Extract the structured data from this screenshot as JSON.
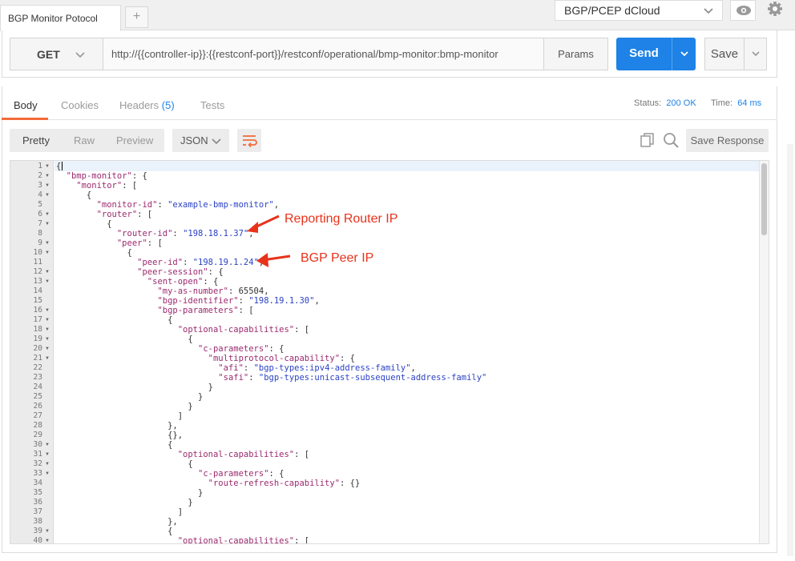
{
  "tabs": {
    "active_tab": "BGP Monitor Potocol",
    "add_label": "+"
  },
  "environment": {
    "selected": "BGP/PCEP dCloud"
  },
  "request": {
    "method": "GET",
    "url": "http://{{controller-ip}}:{{restconf-port}}/restconf/operational/bmp-monitor:bmp-monitor",
    "params_label": "Params",
    "send_label": "Send",
    "save_label": "Save"
  },
  "response": {
    "tabs": [
      {
        "label": "Body"
      },
      {
        "label": "Cookies"
      },
      {
        "label": "Headers",
        "count": "(5)"
      },
      {
        "label": "Tests"
      }
    ],
    "status_label": "Status:",
    "status_value": "200 OK",
    "time_label": "Time:",
    "time_value": "64 ms",
    "views": [
      "Pretty",
      "Raw",
      "Preview"
    ],
    "format": "JSON",
    "save_response_label": "Save Response"
  },
  "code_lines": [
    "{",
    "  \"bmp-monitor\": {",
    "    \"monitor\": [",
    "      {",
    "        \"monitor-id\": \"example-bmp-monitor\",",
    "        \"router\": [",
    "          {",
    "            \"router-id\": \"198.18.1.37\",",
    "            \"peer\": [",
    "              {",
    "                \"peer-id\": \"198.19.1.24\",",
    "                \"peer-session\": {",
    "                  \"sent-open\": {",
    "                    \"my-as-number\": 65504,",
    "                    \"bgp-identifier\": \"198.19.1.30\",",
    "                    \"bgp-parameters\": [",
    "                      {",
    "                        \"optional-capabilities\": [",
    "                          {",
    "                            \"c-parameters\": {",
    "                              \"multiprotocol-capability\": {",
    "                                \"afi\": \"bgp-types:ipv4-address-family\",",
    "                                \"safi\": \"bgp-types:unicast-subsequent-address-family\"",
    "                              }",
    "                            }",
    "                          }",
    "                        ]",
    "                      },",
    "                      {},",
    "                      {",
    "                        \"optional-capabilities\": [",
    "                          {",
    "                            \"c-parameters\": {",
    "                              \"route-refresh-capability\": {}",
    "                            }",
    "                          }",
    "                        ]",
    "                      },",
    "                      {",
    "                        \"optional-capabilities\": ["
  ],
  "annotations": {
    "router_ip": "Reporting Router IP",
    "peer_ip": "BGP Peer IP"
  },
  "colors": {
    "accent": "#1e82e6",
    "active_tab_underline": "#f26b3a",
    "json_key": "#9c2a6f",
    "json_string": "#2b42c4",
    "annotation": "#e8321b"
  }
}
